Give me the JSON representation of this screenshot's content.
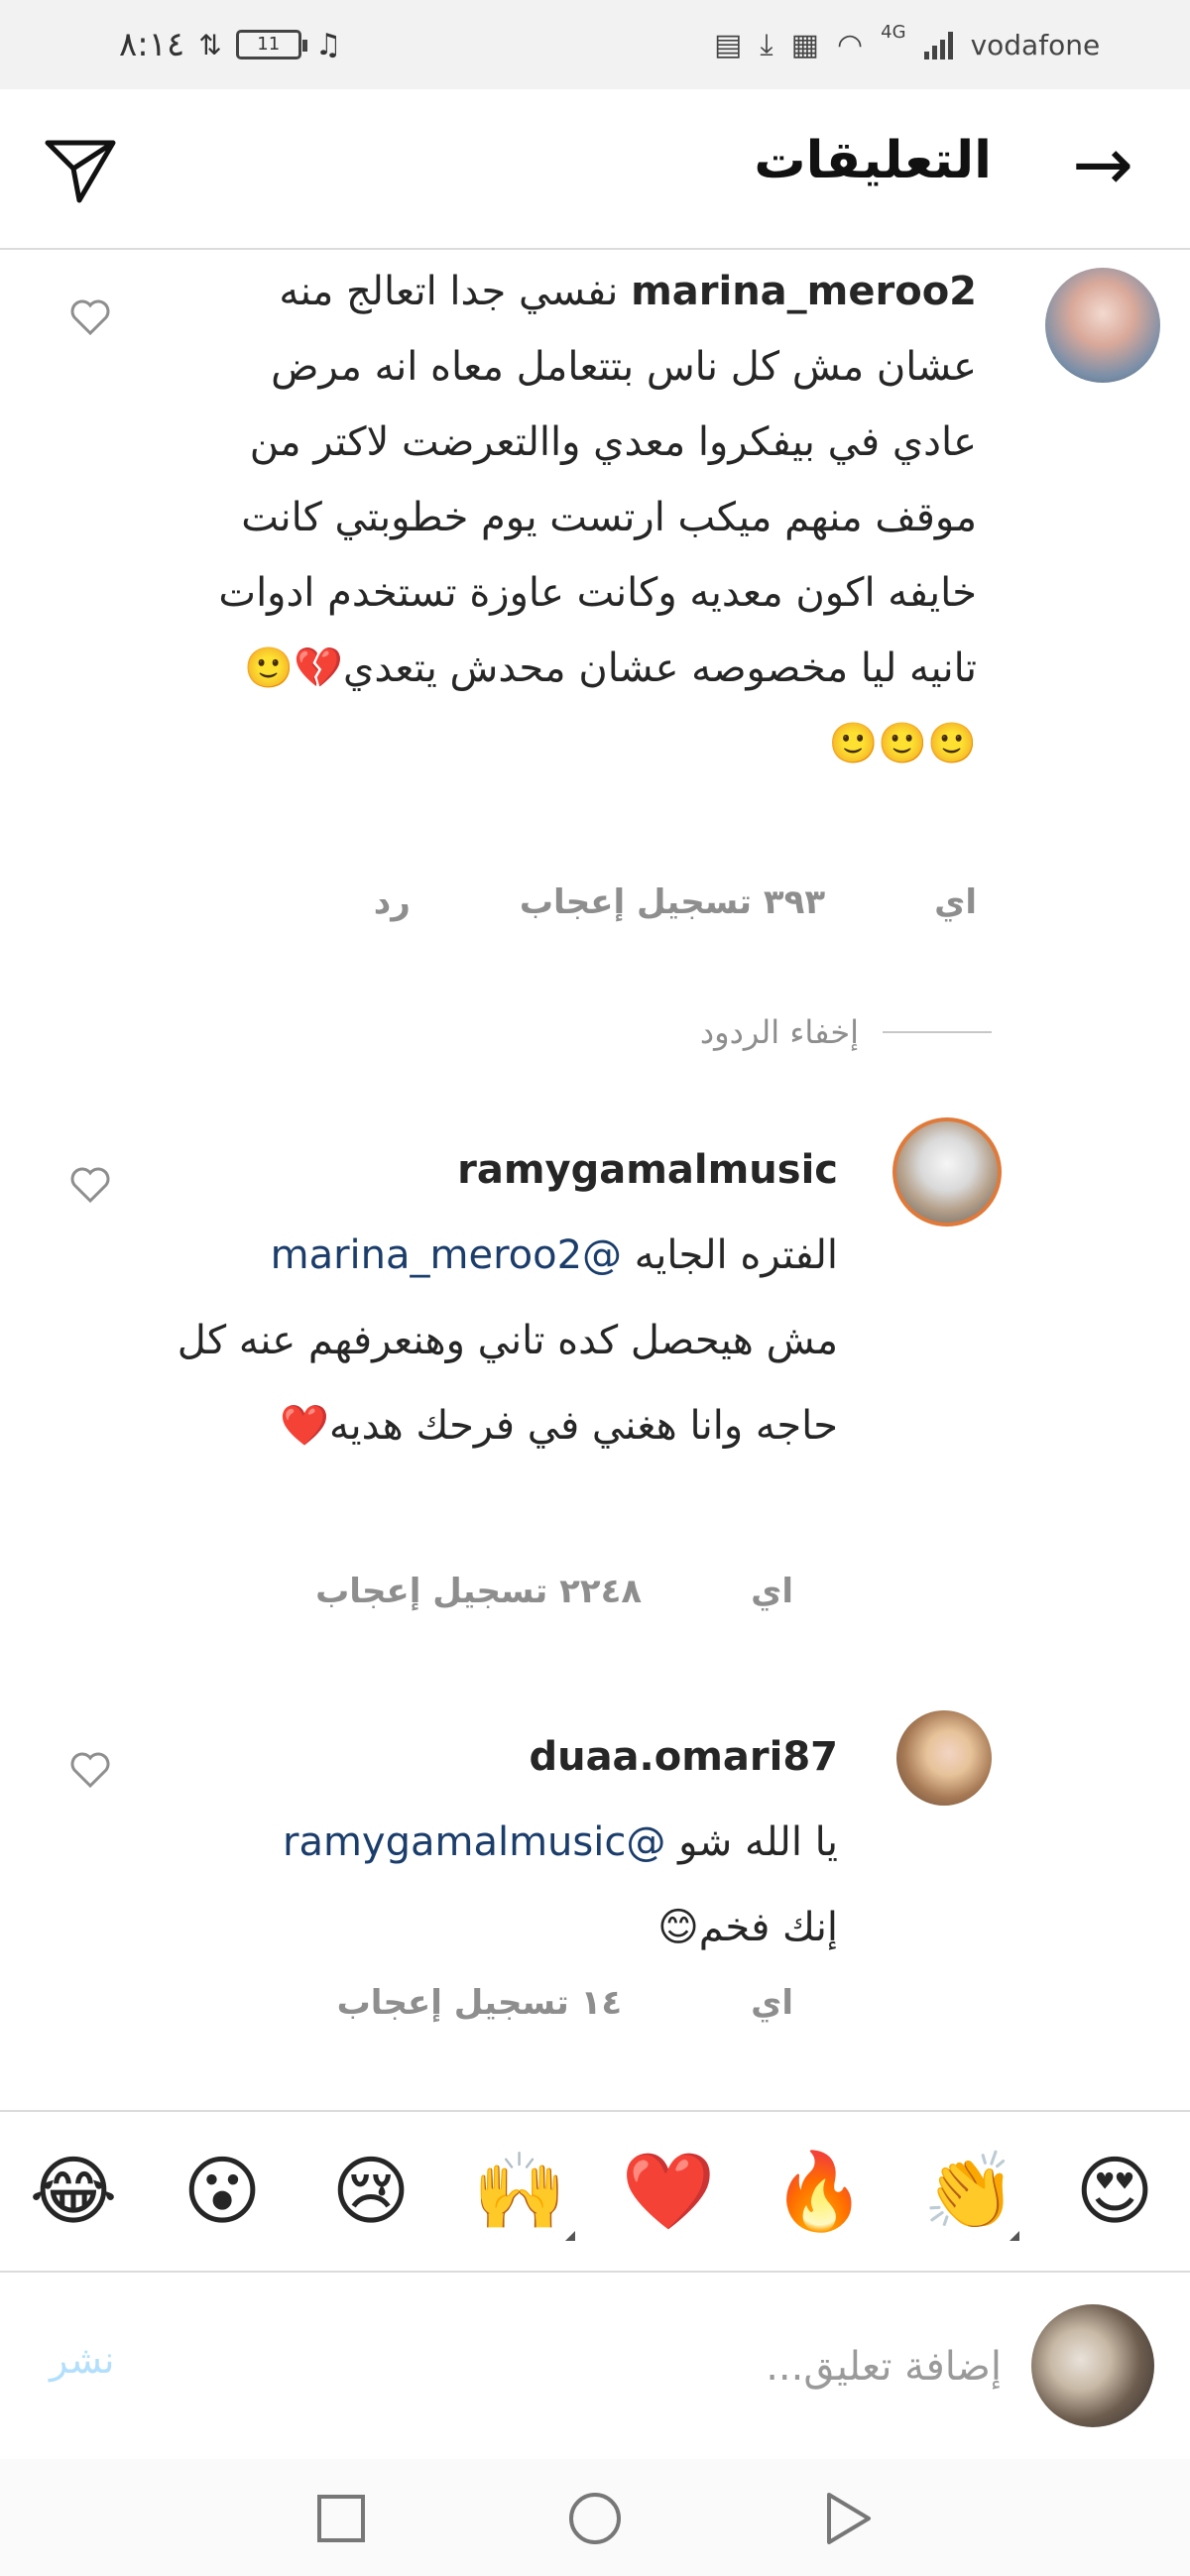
{
  "status_bar": {
    "time": "٨:١٤",
    "battery": "11",
    "network": "4G",
    "carrier": "vodafone"
  },
  "header": {
    "title": "التعليقات"
  },
  "comments": [
    {
      "username": "marina_meroo2",
      "text": "نفسي جدا اتعالج منه عشان مش كل ناس بتتعامل معاه انه مرض عادي في بيفكروا معدي واالتعرضت لاكتر من موقف منهم ميكب ارتست يوم خطوبتي كانت خايفه اكون معديه وكانت عاوزة تستخدم ادوات تانيه ليا مخصوصه عشان محدش يتعدي💔🙂🙂🙂🙂",
      "time": "اي",
      "likes": "٣٩٣ تسجيل إعجاب",
      "reply": "رد"
    }
  ],
  "hide_replies": "إخفاء الردود",
  "replies": [
    {
      "username": "ramygamalmusic",
      "mention": "@marina_meroo2",
      "text_line1": "الفتره الجايه",
      "text_rest": "مش هيحصل كده تاني وهنعرفهم عنه كل حاجه وانا هغني في فرحك هديه❤️",
      "time": "اي",
      "likes": "٢٢٤٨ تسجيل إعجاب"
    },
    {
      "username": "duaa.omari87",
      "mention": "@ramygamalmusic",
      "text_line1": "يا الله شو",
      "text_rest": "إنك فخم😊",
      "time": "اي",
      "likes": "١٤ تسجيل إعجاب"
    }
  ],
  "emoji_bar": [
    "😍",
    "👏",
    "🔥",
    "❤️",
    "🙌",
    "😢",
    "😮",
    "😂"
  ],
  "composer": {
    "placeholder": "إضافة تعليق...",
    "post": "نشر"
  },
  "colors": {
    "mention": "#1b3d6b",
    "post_disabled": "#b2dffc",
    "meta": "#8e8e8e"
  }
}
